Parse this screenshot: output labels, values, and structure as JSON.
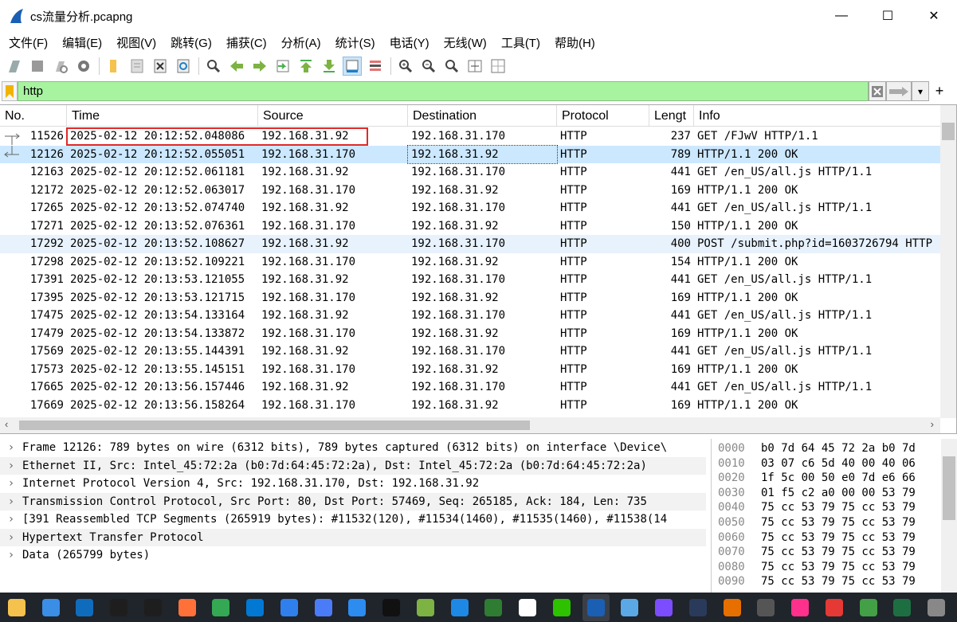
{
  "window": {
    "title": "cs流量分析.pcapng",
    "min": "—",
    "max": "☐",
    "close": "✕"
  },
  "menu": [
    "文件(F)",
    "编辑(E)",
    "视图(V)",
    "跳转(G)",
    "捕获(C)",
    "分析(A)",
    "统计(S)",
    "电话(Y)",
    "无线(W)",
    "工具(T)",
    "帮助(H)"
  ],
  "filter": {
    "value": "http",
    "plus": "+",
    "dropdown": "▾"
  },
  "columns": [
    "No.",
    "Time",
    "Source",
    "Destination",
    "Protocol",
    "Lengt",
    "Info"
  ],
  "packets": [
    {
      "no": "11526",
      "time": "2025-02-12 20:12:52.048086",
      "src": "192.168.31.92",
      "dst": "192.168.31.170",
      "proto": "HTTP",
      "len": "237",
      "info": "GET /FJwV HTTP/1.1"
    },
    {
      "no": "12126",
      "time": "2025-02-12 20:12:52.055051",
      "src": "192.168.31.170",
      "dst": "192.168.31.92",
      "proto": "HTTP",
      "len": "789",
      "info": "HTTP/1.1 200 OK"
    },
    {
      "no": "12163",
      "time": "2025-02-12 20:12:52.061181",
      "src": "192.168.31.92",
      "dst": "192.168.31.170",
      "proto": "HTTP",
      "len": "441",
      "info": "GET /en_US/all.js HTTP/1.1"
    },
    {
      "no": "12172",
      "time": "2025-02-12 20:12:52.063017",
      "src": "192.168.31.170",
      "dst": "192.168.31.92",
      "proto": "HTTP",
      "len": "169",
      "info": "HTTP/1.1 200 OK"
    },
    {
      "no": "17265",
      "time": "2025-02-12 20:13:52.074740",
      "src": "192.168.31.92",
      "dst": "192.168.31.170",
      "proto": "HTTP",
      "len": "441",
      "info": "GET /en_US/all.js HTTP/1.1"
    },
    {
      "no": "17271",
      "time": "2025-02-12 20:13:52.076361",
      "src": "192.168.31.170",
      "dst": "192.168.31.92",
      "proto": "HTTP",
      "len": "150",
      "info": "HTTP/1.1 200 OK"
    },
    {
      "no": "17292",
      "time": "2025-02-12 20:13:52.108627",
      "src": "192.168.31.92",
      "dst": "192.168.31.170",
      "proto": "HTTP",
      "len": "400",
      "info": "POST /submit.php?id=1603726794 HTTP"
    },
    {
      "no": "17298",
      "time": "2025-02-12 20:13:52.109221",
      "src": "192.168.31.170",
      "dst": "192.168.31.92",
      "proto": "HTTP",
      "len": "154",
      "info": "HTTP/1.1 200 OK"
    },
    {
      "no": "17391",
      "time": "2025-02-12 20:13:53.121055",
      "src": "192.168.31.92",
      "dst": "192.168.31.170",
      "proto": "HTTP",
      "len": "441",
      "info": "GET /en_US/all.js HTTP/1.1"
    },
    {
      "no": "17395",
      "time": "2025-02-12 20:13:53.121715",
      "src": "192.168.31.170",
      "dst": "192.168.31.92",
      "proto": "HTTP",
      "len": "169",
      "info": "HTTP/1.1 200 OK"
    },
    {
      "no": "17475",
      "time": "2025-02-12 20:13:54.133164",
      "src": "192.168.31.92",
      "dst": "192.168.31.170",
      "proto": "HTTP",
      "len": "441",
      "info": "GET /en_US/all.js HTTP/1.1"
    },
    {
      "no": "17479",
      "time": "2025-02-12 20:13:54.133872",
      "src": "192.168.31.170",
      "dst": "192.168.31.92",
      "proto": "HTTP",
      "len": "169",
      "info": "HTTP/1.1 200 OK"
    },
    {
      "no": "17569",
      "time": "2025-02-12 20:13:55.144391",
      "src": "192.168.31.92",
      "dst": "192.168.31.170",
      "proto": "HTTP",
      "len": "441",
      "info": "GET /en_US/all.js HTTP/1.1"
    },
    {
      "no": "17573",
      "time": "2025-02-12 20:13:55.145151",
      "src": "192.168.31.170",
      "dst": "192.168.31.92",
      "proto": "HTTP",
      "len": "169",
      "info": "HTTP/1.1 200 OK"
    },
    {
      "no": "17665",
      "time": "2025-02-12 20:13:56.157446",
      "src": "192.168.31.92",
      "dst": "192.168.31.170",
      "proto": "HTTP",
      "len": "441",
      "info": "GET /en_US/all.js HTTP/1.1"
    },
    {
      "no": "17669",
      "time": "2025-02-12 20:13:56.158264",
      "src": "192.168.31.170",
      "dst": "192.168.31.92",
      "proto": "HTTP",
      "len": "169",
      "info": "HTTP/1.1 200 OK"
    }
  ],
  "details": [
    "Frame 12126: 789 bytes on wire (6312 bits), 789 bytes captured (6312 bits) on interface \\Device\\",
    "Ethernet II, Src: Intel_45:72:2a (b0:7d:64:45:72:2a), Dst: Intel_45:72:2a (b0:7d:64:45:72:2a)",
    "Internet Protocol Version 4, Src: 192.168.31.170, Dst: 192.168.31.92",
    "Transmission Control Protocol, Src Port: 80, Dst Port: 57469, Seq: 265185, Ack: 184, Len: 735",
    "[391 Reassembled TCP Segments (265919 bytes): #11532(120), #11534(1460), #11535(1460), #11538(14",
    "Hypertext Transfer Protocol",
    "Data (265799 bytes)"
  ],
  "hex": [
    {
      "off": "0000",
      "bytes": "b0 7d 64 45 72 2a b0 7d"
    },
    {
      "off": "0010",
      "bytes": "03 07 c6 5d 40 00 40 06"
    },
    {
      "off": "0020",
      "bytes": "1f 5c 00 50 e0 7d e6 66"
    },
    {
      "off": "0030",
      "bytes": "01 f5 c2 a0 00 00 53 79"
    },
    {
      "off": "0040",
      "bytes": "75 cc 53 79 75 cc 53 79"
    },
    {
      "off": "0050",
      "bytes": "75 cc 53 79 75 cc 53 79"
    },
    {
      "off": "0060",
      "bytes": "75 cc 53 79 75 cc 53 79"
    },
    {
      "off": "0070",
      "bytes": "75 cc 53 79 75 cc 53 79"
    },
    {
      "off": "0080",
      "bytes": "75 cc 53 79 75 cc 53 79"
    },
    {
      "off": "0090",
      "bytes": "75 cc 53 79 75 cc 53 79"
    }
  ],
  "taskbar_icons": [
    "file-explorer",
    "start",
    "outlook",
    "dell",
    "dell-app",
    "firefox",
    "chrome",
    "vscode",
    "app-blue",
    "app-circle",
    "feishu",
    "qq",
    "app-green",
    "app-blue2",
    "terminal",
    "typora",
    "wechat",
    "wireshark",
    "app-flower",
    "app-bolt",
    "app-dark",
    "java",
    "app-doc",
    "idea",
    "app-red",
    "app-refresh",
    "excel",
    "more"
  ],
  "colors": {
    "selected_row": "#cce8ff",
    "alt_row": "#e8f2fc",
    "filter_bg": "#a8f3a0",
    "highlight_box": "#e02a2a",
    "taskbar": "#20242b"
  }
}
